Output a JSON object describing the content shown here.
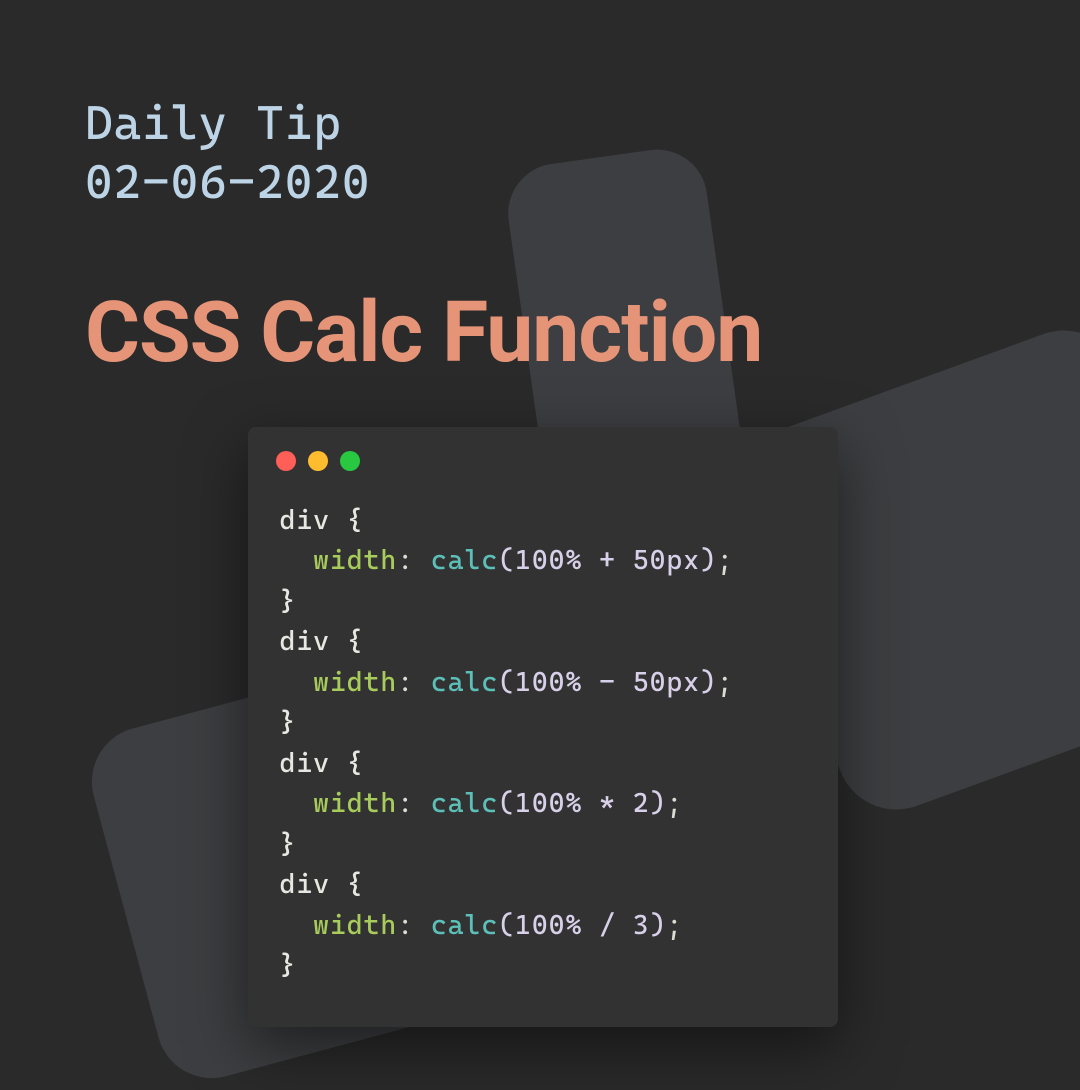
{
  "header": {
    "subtitle_line1": "Daily Tip",
    "subtitle_line2": "02-06-2020",
    "title": "CSS Calc Function"
  },
  "code": {
    "blocks": [
      {
        "selector": "div",
        "prop": "width",
        "func": "calc",
        "args": "100% + 50px"
      },
      {
        "selector": "div",
        "prop": "width",
        "func": "calc",
        "args": "100% - 50px"
      },
      {
        "selector": "div",
        "prop": "width",
        "func": "calc",
        "args": "100% * 2"
      },
      {
        "selector": "div",
        "prop": "width",
        "func": "calc",
        "args": "100% / 3"
      }
    ]
  },
  "colors": {
    "background": "#2a2a2a",
    "code_bg": "#323232",
    "subtitle": "#bcd4e6",
    "title": "#e59478",
    "prop": "#a8cc5c",
    "func": "#5cbfb8",
    "value": "#d8d0e8"
  }
}
